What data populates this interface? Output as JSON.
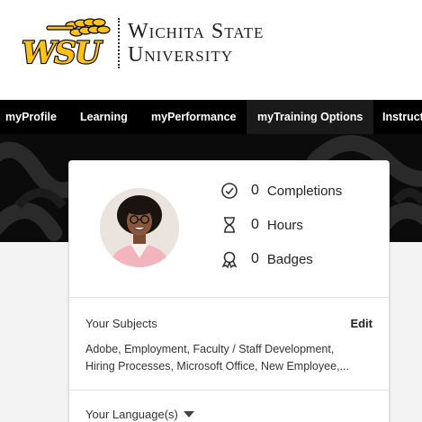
{
  "brand": {
    "logo_mark": "WSU",
    "name_line1": "Wichita State",
    "name_line2": "University",
    "colors": {
      "gold": "#FFC217",
      "black": "#000000"
    }
  },
  "nav": {
    "items": [
      {
        "label": "myProfile"
      },
      {
        "label": "Learning"
      },
      {
        "label": "myPerformance"
      },
      {
        "label": "myTraining Options",
        "active": true
      },
      {
        "label": "Instructo"
      }
    ]
  },
  "stats": [
    {
      "icon": "check-circle-icon",
      "value": "0",
      "label": "Completions"
    },
    {
      "icon": "hourglass-icon",
      "value": "0",
      "label": "Hours"
    },
    {
      "icon": "badge-ribbon-icon",
      "value": "0",
      "label": "Badges"
    }
  ],
  "subjects": {
    "title": "Your Subjects",
    "edit_label": "Edit",
    "line1": "Adobe, Employment, Faculty / Staff Development,",
    "line2": "Hiring Processes, Microsoft Office, New Employee,..."
  },
  "language": {
    "title": "Your Language(s)"
  }
}
